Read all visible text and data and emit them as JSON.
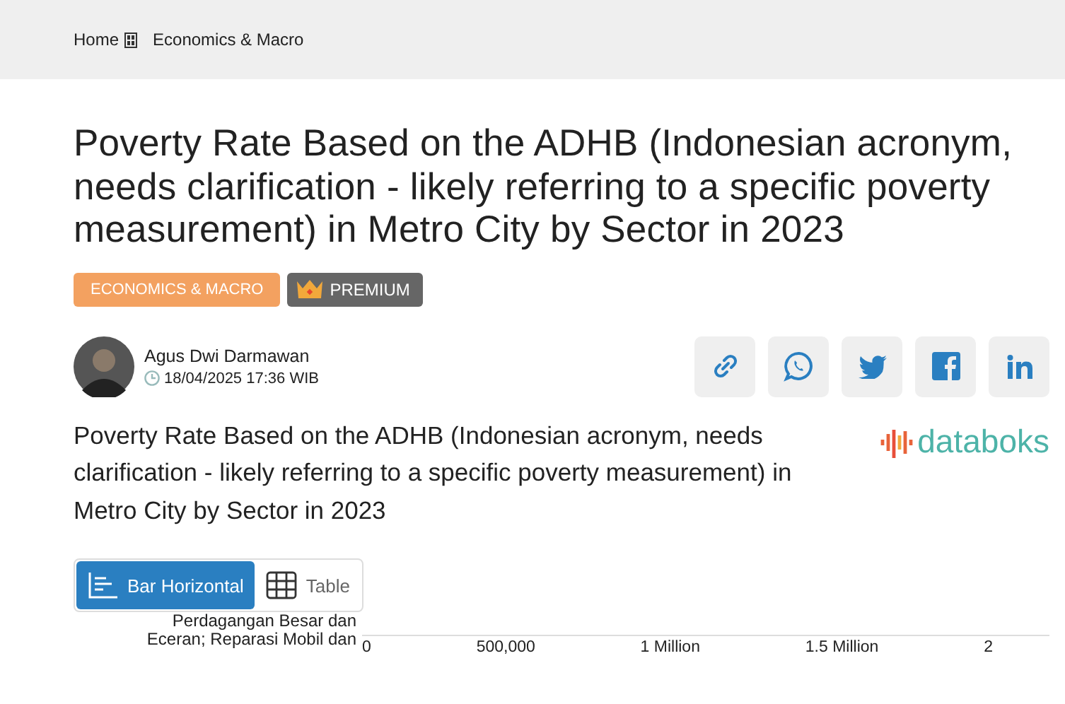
{
  "breadcrumb": [
    "Home",
    "Economics & Macro"
  ],
  "title": "Poverty Rate Based on the ADHB (Indonesian acronym, needs clarification - likely referring to a specific poverty measurement) in Metro City by Sector in 2023",
  "badges": [
    {
      "label": "ECONOMICS & MACRO",
      "kind": "category"
    },
    {
      "label": "PREMIUM",
      "kind": "premium"
    }
  ],
  "author": {
    "name": "Agus Dwi Darmawan",
    "datetime": "18/04/2025 17:36 WIB"
  },
  "share_buttons": [
    {
      "kind": "link"
    },
    {
      "kind": "whatsapp"
    },
    {
      "kind": "twitter"
    },
    {
      "kind": "facebook"
    },
    {
      "kind": "linkedin"
    }
  ],
  "chart_title": "Poverty Rate Based on the ADHB (Indonesian acronym, needs clarification - likely referring to a specific poverty measurement) in Metro City by Sector in 2023",
  "logo": "databoks",
  "view_toggle": [
    {
      "label": "Bar Horizontal",
      "kind": "bar",
      "selected": true
    },
    {
      "label": "Table",
      "kind": "table",
      "selected": false
    }
  ],
  "chart_fragment": {
    "category_label_lines": [
      "Perdagangan Besar dan",
      "Eceran; Reparasi Mobil dan"
    ],
    "axis_ticks": [
      "0",
      "500,000",
      "1 Million",
      "1.5 Million",
      "2"
    ]
  }
}
